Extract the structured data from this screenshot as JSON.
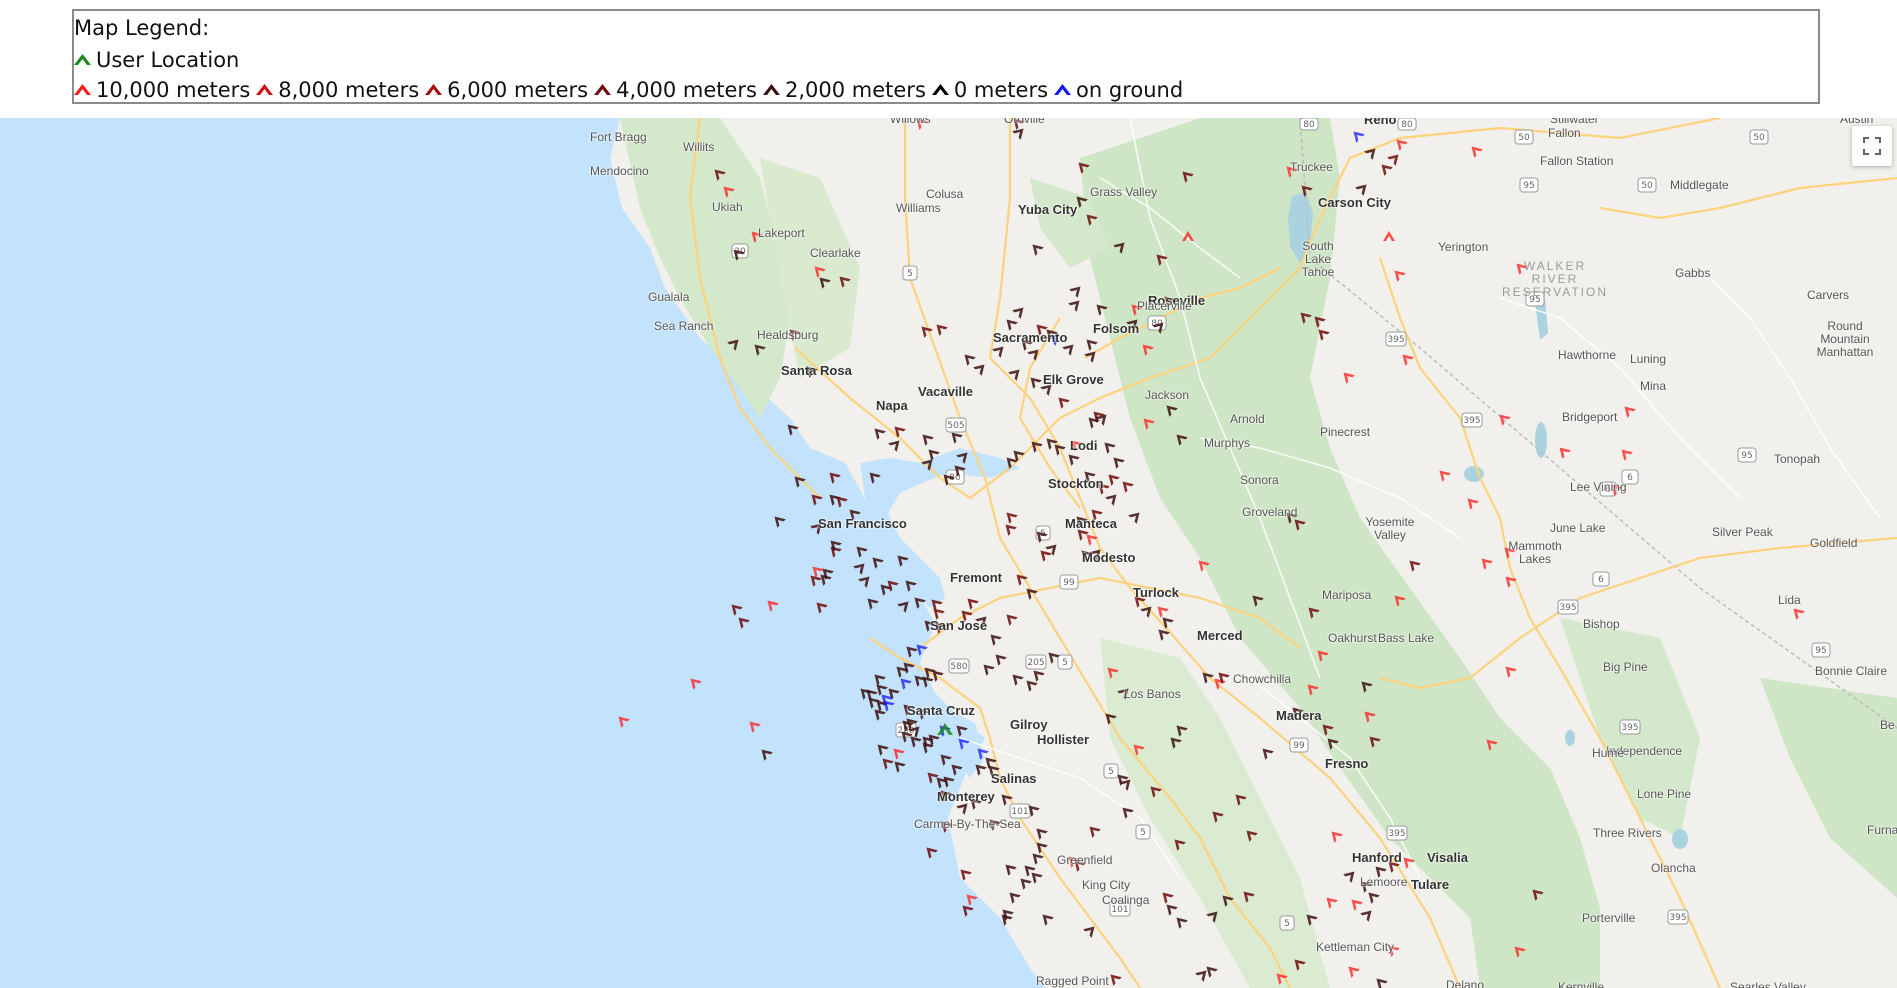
{
  "legend": {
    "title": "Map Legend:",
    "user_location": {
      "label": "User Location",
      "color": "#1a8a1a",
      "icon": "aircraft-chevron-icon"
    },
    "altitudes": [
      {
        "label": "10,000 meters",
        "color": "#ff1a1a"
      },
      {
        "label": "8,000 meters",
        "color": "#d10f0f"
      },
      {
        "label": "6,000 meters",
        "color": "#a80d0d"
      },
      {
        "label": "4,000 meters",
        "color": "#6e0a0a"
      },
      {
        "label": "2,000 meters",
        "color": "#3d1010"
      },
      {
        "label": "0 meters",
        "color": "#000000"
      },
      {
        "label": "on ground",
        "color": "#1515ff"
      }
    ]
  },
  "map": {
    "colors": {
      "ocean": "#c3e2fb",
      "land": "#f1f0ec",
      "forest": "#cfe6c6",
      "highway": "#fcd27c",
      "road": "#ffffff"
    },
    "cities": [
      {
        "name": "Willows"
      },
      {
        "name": "Oroville"
      },
      {
        "name": "Reno"
      },
      {
        "name": "Fort Bragg"
      },
      {
        "name": "Willits"
      },
      {
        "name": "Mendocino"
      },
      {
        "name": "Colusa"
      },
      {
        "name": "Ukiah"
      },
      {
        "name": "Williams"
      },
      {
        "name": "Yuba City"
      },
      {
        "name": "Grass Valley"
      },
      {
        "name": "Truckee"
      },
      {
        "name": "Carson City"
      },
      {
        "name": "Fallon"
      },
      {
        "name": "Fallon Station"
      },
      {
        "name": "Middlegate"
      },
      {
        "name": "Stillwater"
      },
      {
        "name": "Austin"
      },
      {
        "name": "Lakeport"
      },
      {
        "name": "Clearlake"
      },
      {
        "name": "South Lake Tahoe"
      },
      {
        "name": "Yerington"
      },
      {
        "name": "Gabbs"
      },
      {
        "name": "Gualala"
      },
      {
        "name": "Roseville"
      },
      {
        "name": "Placerville"
      },
      {
        "name": "Carvers"
      },
      {
        "name": "Sea Ranch"
      },
      {
        "name": "Healdsburg"
      },
      {
        "name": "Sacramento"
      },
      {
        "name": "Folsom"
      },
      {
        "name": "Round Mountain Manhattan"
      },
      {
        "name": "Santa Rosa"
      },
      {
        "name": "Elk Grove"
      },
      {
        "name": "Hawthorne"
      },
      {
        "name": "Luning"
      },
      {
        "name": "Vacaville"
      },
      {
        "name": "Mina"
      },
      {
        "name": "Napa"
      },
      {
        "name": "Jackson"
      },
      {
        "name": "Arnold"
      },
      {
        "name": "Bridgeport"
      },
      {
        "name": "Lodi"
      },
      {
        "name": "Pinecrest"
      },
      {
        "name": "Murphys"
      },
      {
        "name": "Tonopah"
      },
      {
        "name": "Stockton"
      },
      {
        "name": "Sonora"
      },
      {
        "name": "Lee Vining"
      },
      {
        "name": "San Francisco"
      },
      {
        "name": "Manteca"
      },
      {
        "name": "Groveland"
      },
      {
        "name": "Yosemite Valley"
      },
      {
        "name": "June Lake"
      },
      {
        "name": "Mammoth Lakes"
      },
      {
        "name": "Silver Peak"
      },
      {
        "name": "Goldfield"
      },
      {
        "name": "Modesto"
      },
      {
        "name": "Fremont"
      },
      {
        "name": "Turlock"
      },
      {
        "name": "Mariposa"
      },
      {
        "name": "Lida"
      },
      {
        "name": "San Jose"
      },
      {
        "name": "Merced"
      },
      {
        "name": "Oakhurst"
      },
      {
        "name": "Bass Lake"
      },
      {
        "name": "Bishop"
      },
      {
        "name": "Big Pine"
      },
      {
        "name": "Bonnie Claire"
      },
      {
        "name": "Chowchilla"
      },
      {
        "name": "Los Banos"
      },
      {
        "name": "Santa Cruz"
      },
      {
        "name": "Gilroy"
      },
      {
        "name": "Madera"
      },
      {
        "name": "Hollister"
      },
      {
        "name": "Independence"
      },
      {
        "name": "Fresno"
      },
      {
        "name": "Salinas"
      },
      {
        "name": "Monterey"
      },
      {
        "name": "Lone Pine"
      },
      {
        "name": "Carmel-By-The-Sea"
      },
      {
        "name": "Three Rivers"
      },
      {
        "name": "Greenfield"
      },
      {
        "name": "Hanford"
      },
      {
        "name": "Visalia"
      },
      {
        "name": "Furnace Cr"
      },
      {
        "name": "Lemoore"
      },
      {
        "name": "Tulare"
      },
      {
        "name": "King City"
      },
      {
        "name": "Olancha"
      },
      {
        "name": "Coalinga"
      },
      {
        "name": "Porterville"
      },
      {
        "name": "Kettleman City"
      },
      {
        "name": "Ragged Point"
      },
      {
        "name": "Delano"
      },
      {
        "name": "Kernville"
      },
      {
        "name": "Searles Valley"
      },
      {
        "name": "Hume"
      },
      {
        "name": "Be"
      }
    ],
    "regions": [
      {
        "name": "WALKER RIVER RESERVATION"
      }
    ],
    "fullscreen": {
      "icon": "fullscreen-icon"
    }
  }
}
